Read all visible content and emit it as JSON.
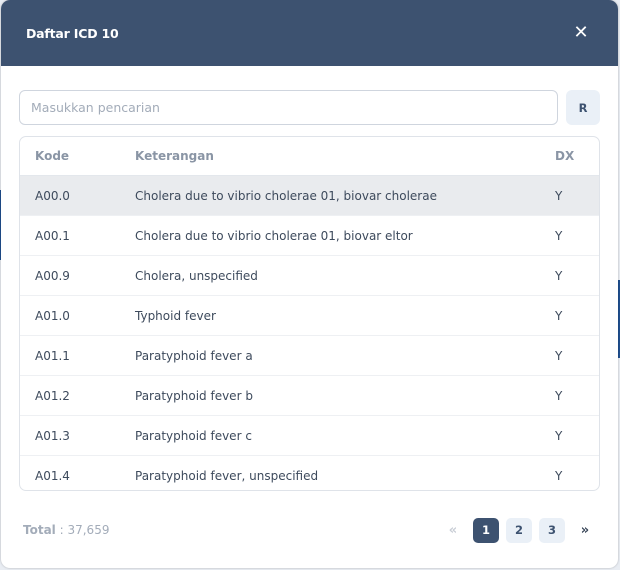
{
  "modal": {
    "title": "Daftar ICD 10",
    "close_icon": "close-icon"
  },
  "search": {
    "placeholder": "Masukkan pencarian",
    "value": "",
    "reset_label": "R"
  },
  "table": {
    "headers": {
      "code": "Kode",
      "description": "Keterangan",
      "dx": "DX"
    },
    "rows": [
      {
        "code": "A00.0",
        "description": "Cholera due to vibrio cholerae 01, biovar cholerae",
        "dx": "Y"
      },
      {
        "code": "A00.1",
        "description": "Cholera due to vibrio cholerae 01, biovar eltor",
        "dx": "Y"
      },
      {
        "code": "A00.9",
        "description": "Cholera, unspecified",
        "dx": "Y"
      },
      {
        "code": "A01.0",
        "description": "Typhoid fever",
        "dx": "Y"
      },
      {
        "code": "A01.1",
        "description": "Paratyphoid fever a",
        "dx": "Y"
      },
      {
        "code": "A01.2",
        "description": "Paratyphoid fever b",
        "dx": "Y"
      },
      {
        "code": "A01.3",
        "description": "Paratyphoid fever c",
        "dx": "Y"
      },
      {
        "code": "A01.4",
        "description": "Paratyphoid fever, unspecified",
        "dx": "Y"
      }
    ]
  },
  "footer": {
    "total_label": "Total",
    "total_separator": " : ",
    "total_value": "37,659"
  },
  "pagination": {
    "prev": "«",
    "next": "»",
    "pages": [
      "1",
      "2",
      "3"
    ],
    "current": "1"
  },
  "colors": {
    "header_bg": "#3d5270",
    "accent": "#3d5270",
    "selected_row": "#e9ebee"
  }
}
